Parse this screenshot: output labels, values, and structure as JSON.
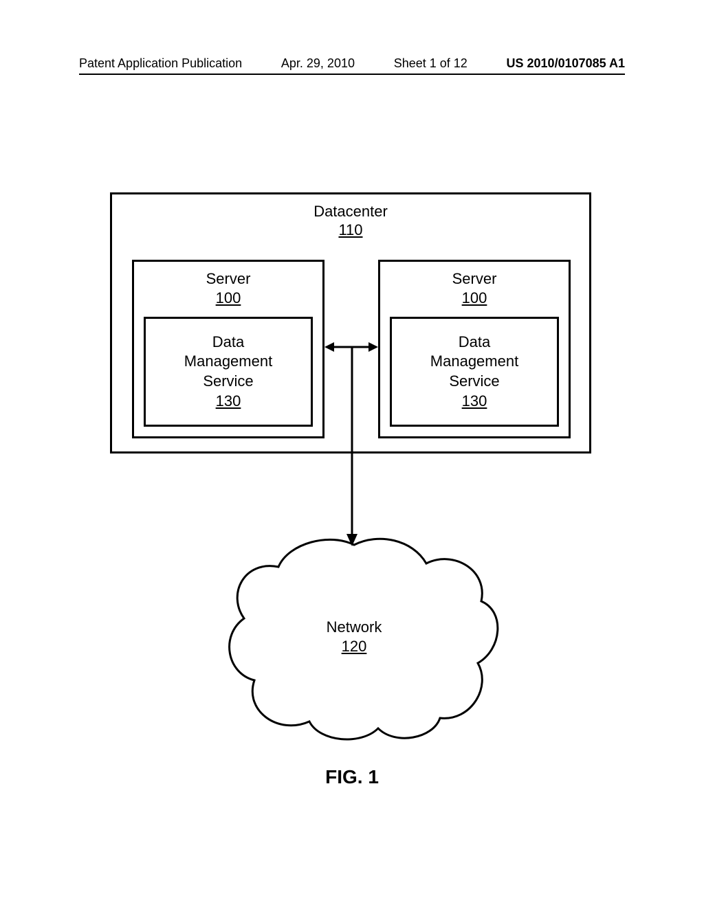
{
  "header": {
    "publication": "Patent Application Publication",
    "date": "Apr. 29, 2010",
    "sheet": "Sheet 1 of 12",
    "docnum": "US 2010/0107085 A1"
  },
  "datacenter": {
    "label": "Datacenter",
    "num": "110"
  },
  "servers": [
    {
      "label": "Server",
      "num": "100",
      "dms": {
        "line1": "Data",
        "line2": "Management",
        "line3": "Service",
        "num": "130"
      }
    },
    {
      "label": "Server",
      "num": "100",
      "dms": {
        "line1": "Data",
        "line2": "Management",
        "line3": "Service",
        "num": "130"
      }
    }
  ],
  "network": {
    "label": "Network",
    "num": "120"
  },
  "figure": "FIG. 1"
}
